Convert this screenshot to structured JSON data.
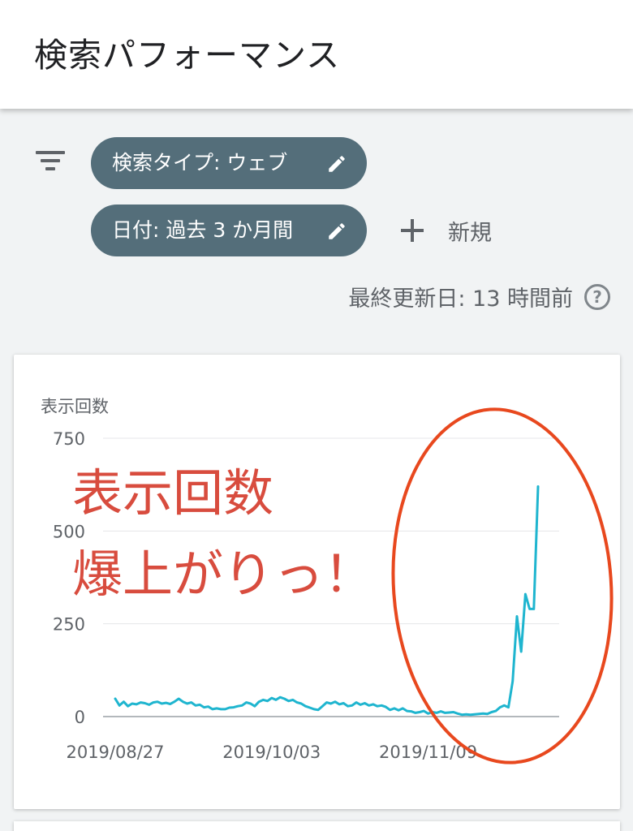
{
  "header": {
    "title": "検索パフォーマンス"
  },
  "filters": {
    "chips": [
      {
        "label": "検索タイプ: ウェブ",
        "icon": "pencil-icon"
      },
      {
        "label": "日付: 過去 3 か月間",
        "icon": "pencil-icon"
      }
    ],
    "add_new_label": "新規",
    "last_updated": "最終更新日: 13 時間前",
    "help_icon": "question-circle-icon",
    "filter_icon": "filter-list-icon"
  },
  "colors": {
    "series": "#1fb5cf",
    "chip_bg": "#546e7a",
    "annotation": "#d84c3e",
    "ellipse": "#e8481e"
  },
  "chart_data": {
    "type": "line",
    "title": "",
    "ylabel": "表示回数",
    "xlabel": "",
    "ylim": [
      0,
      750
    ],
    "yticks": [
      0,
      250,
      500,
      750
    ],
    "xtick_labels": [
      "2019/08/27",
      "2019/10/03",
      "2019/11/09"
    ],
    "grid": true,
    "series": [
      {
        "values": [
          48,
          30,
          40,
          28,
          35,
          33,
          38,
          36,
          32,
          38,
          40,
          35,
          37,
          34,
          40,
          48,
          40,
          35,
          38,
          30,
          32,
          25,
          27,
          20,
          22,
          20,
          20,
          24,
          25,
          28,
          30,
          38,
          35,
          28,
          40,
          45,
          42,
          50,
          45,
          52,
          48,
          42,
          45,
          38,
          35,
          28,
          24,
          20,
          18,
          28,
          38,
          35,
          40,
          33,
          36,
          28,
          30,
          38,
          32,
          36,
          30,
          33,
          28,
          30,
          26,
          18,
          22,
          17,
          22,
          15,
          14,
          10,
          12,
          15,
          8,
          12,
          10,
          14,
          10,
          11,
          12,
          8,
          5,
          6,
          5,
          6,
          7,
          8,
          7,
          12,
          15,
          25,
          30,
          25,
          95,
          270,
          175,
          330,
          290,
          290,
          620
        ]
      }
    ],
    "annotation": "表示回数\n爆上がりっ！"
  }
}
